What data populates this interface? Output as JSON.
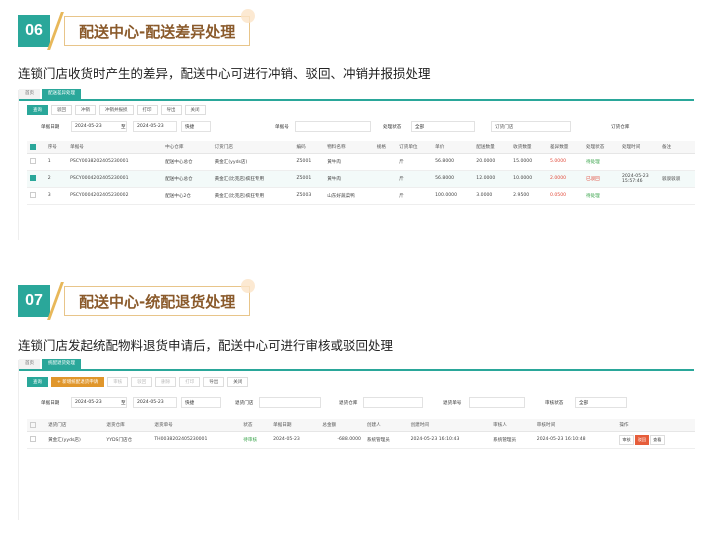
{
  "section6": {
    "number": "06",
    "title": "配送中心-配送差异处理",
    "description": "连锁门店收货时产生的差异，配送中心可进行冲销、驳回、冲销并报损处理",
    "tabs": [
      "首页",
      "配送差异处理"
    ],
    "toolbar": [
      "查询",
      "驳回",
      "冲销",
      "冲销并报损",
      "打印",
      "导出",
      "关闭"
    ],
    "filters": {
      "date_label": "单据日期",
      "date_from": "2024-05-23",
      "to": "至",
      "date_to": "2024-05-23",
      "quick": "快捷",
      "doc_no_label": "单据号",
      "status_label": "处理状态",
      "status_value": "全部",
      "order_store_placeholder": "订货门店",
      "order_warehouse_label": "订货仓库"
    },
    "columns": [
      "",
      "序号",
      "单据号",
      "中心仓库",
      "订货门店",
      "编码",
      "物料名称",
      "规格",
      "订货单位",
      "单价",
      "配送数量",
      "收货数量",
      "差异数量",
      "处理状态",
      "处理时间",
      "备注"
    ],
    "rows": [
      {
        "checked": false,
        "seq": "1",
        "doc": "PSCY0038202405230001",
        "wh": "配送中心总仓",
        "store": "黄金汇(yyds店)",
        "code": "Z5001",
        "item": "黄牛肉",
        "spec": "",
        "unit": "斤",
        "price": "56.8000",
        "dqty": "20.0000",
        "rqty": "15.0000",
        "diff": "5.0000",
        "status": "待处理",
        "time": "",
        "remark": ""
      },
      {
        "checked": true,
        "seq": "2",
        "doc": "PSCY0004202405230001",
        "wh": "配送中心总仓",
        "store": "黄金汇(比克店)疯狂专用",
        "code": "Z5001",
        "item": "黄牛肉",
        "spec": "",
        "unit": "斤",
        "price": "56.8000",
        "dqty": "12.0000",
        "rqty": "10.0000",
        "diff": "2.0000",
        "status": "已驳回",
        "time": "2024-05-23 15:57:46",
        "remark": "驳驳驳驳"
      },
      {
        "checked": false,
        "seq": "3",
        "doc": "PSCY0004202405230002",
        "wh": "配送中心2仓",
        "store": "黄金汇(比克店)疯狂专用",
        "code": "Z5003",
        "item": "山东好蔬菜鸭",
        "spec": "",
        "unit": "斤",
        "price": "100.0000",
        "dqty": "3.0000",
        "rqty": "2.9500",
        "diff": "0.0500",
        "status": "待处理",
        "time": "",
        "remark": ""
      }
    ]
  },
  "section7": {
    "number": "07",
    "title": "配送中心-统配退货处理",
    "description": "连锁门店发起统配物料退货申请后，配送中心可进行审核或驳回处理",
    "tabs": [
      "首页",
      "统配退货处理"
    ],
    "toolbar": [
      "查询",
      "+ 新增统配退货申请",
      "审核",
      "驳回",
      "删除",
      "打印",
      "导出",
      "关闭"
    ],
    "filters": {
      "date_label": "单据日期",
      "date_from": "2024-05-23",
      "to": "至",
      "date_to": "2024-05-23",
      "quick": "快捷",
      "return_store_label": "退货门店",
      "return_wh_label": "退货仓库",
      "return_no_label": "退货单号",
      "audit_label": "审核状态",
      "audit_value": "全部"
    },
    "columns": [
      "",
      "退货门店",
      "退货仓库",
      "退货单号",
      "状态",
      "单据日期",
      "总金额",
      "创建人",
      "创建时间",
      "审核人",
      "审核时间",
      "操作"
    ],
    "rows": [
      {
        "store": "黄金汇(yyds店)",
        "wh": "YYDS门店仓",
        "no": "TH0038202405230001",
        "status": "待审核",
        "date": "2024-05-23",
        "total": "-688.0000",
        "creator": "系统管理员",
        "ctime": "2024-05-23 16:10:43",
        "auditor": "系统管理员",
        "atime": "2024-05-23 16:10:48",
        "ops": [
          "审核",
          "驳回",
          "查看"
        ]
      }
    ]
  }
}
